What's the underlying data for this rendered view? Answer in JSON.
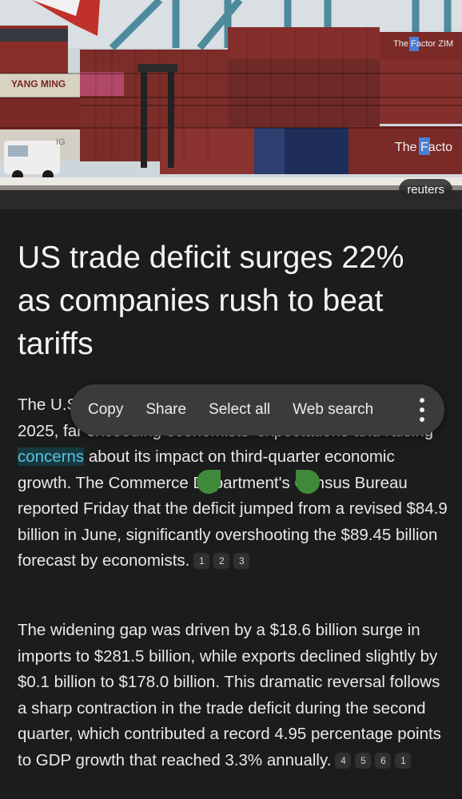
{
  "hero": {
    "source": "reuters",
    "brand_left": "YANG MING",
    "brand_right_top": "The Factor ZIM",
    "brand_right_bottom": "The Facto",
    "truck_label": "IG"
  },
  "article": {
    "headline": "US trade deficit surges 22% as companies rush to beat tariffs",
    "p1": {
      "before": "The U.S. trade deficit widened to $103.6 billion in July 2025, far exceeding economists' expectations and raising ",
      "highlight": "concerns",
      "after": " about its impact on third-quarter economic growth. The Commerce Department's Census Bureau reported Friday that the deficit jumped from a revised $84.9 billion in June, significantly overshooting the $89.45 billion forecast by economists.",
      "citations": [
        "1",
        "2",
        "3"
      ]
    },
    "p2": {
      "text": "The widening gap was driven by a $18.6 billion surge in imports to $281.5 billion, while exports declined slightly by $0.1 billion to $178.0 billion. This dramatic reversal follows a sharp contraction in the trade deficit during the second quarter, which contributed a record 4.95 percentage points to GDP growth that reached 3.3% annually.",
      "citations": [
        "4",
        "5",
        "6",
        "1"
      ]
    }
  },
  "toolbar": {
    "copy": "Copy",
    "share": "Share",
    "select_all": "Select all",
    "web_search": "Web search",
    "more_icon": "more-vert-icon"
  },
  "colors": {
    "background": "#1b1c1c",
    "highlight_text": "#58c1de",
    "highlight_bg": "#16383f",
    "selection_handle": "#3f8a3a",
    "toolbar_bg": "#3a3b3a"
  }
}
